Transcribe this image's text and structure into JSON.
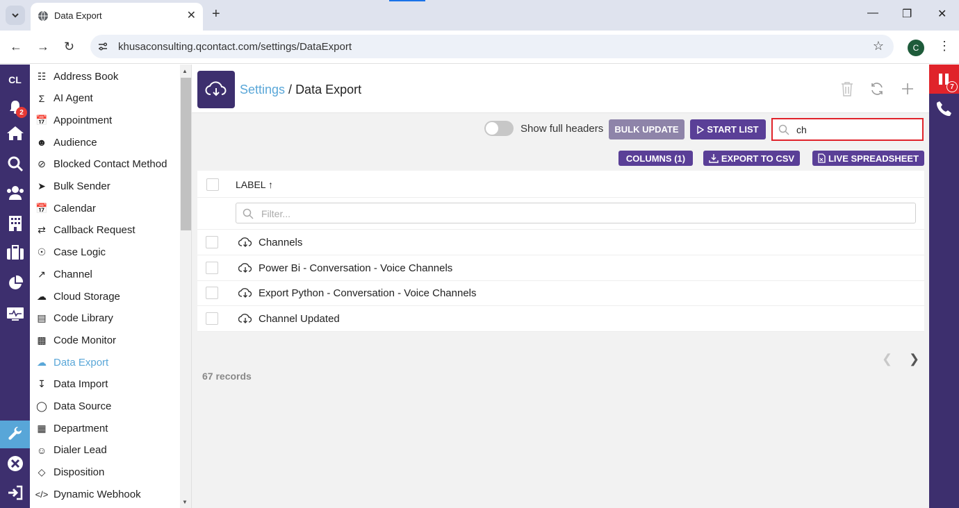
{
  "browser": {
    "tab_title": "Data Export",
    "url": "khusaconsulting.qcontact.com/settings/DataExport",
    "profile_initial": "C",
    "new_tab": "+",
    "close": "✕"
  },
  "rail": {
    "avatar": "CL",
    "notification_count": "2",
    "icons": [
      "bell-icon",
      "home-icon",
      "search-icon",
      "users-icon",
      "building-icon",
      "briefcase-icon",
      "pie-chart-icon",
      "monitor-icon",
      "wrench-icon",
      "close-circle-icon",
      "logout-icon"
    ]
  },
  "settings_list": [
    {
      "label": "Address Book",
      "icon": "address-book-icon"
    },
    {
      "label": "AI Agent",
      "icon": "sigma-icon"
    },
    {
      "label": "Appointment",
      "icon": "calendar-icon"
    },
    {
      "label": "Audience",
      "icon": "audience-icon"
    },
    {
      "label": "Blocked Contact Method",
      "icon": "blocked-icon"
    },
    {
      "label": "Bulk Sender",
      "icon": "bulk-sender-icon"
    },
    {
      "label": "Calendar",
      "icon": "calendar-icon"
    },
    {
      "label": "Callback Request",
      "icon": "callback-icon"
    },
    {
      "label": "Case Logic",
      "icon": "case-logic-icon"
    },
    {
      "label": "Channel",
      "icon": "channel-icon"
    },
    {
      "label": "Cloud Storage",
      "icon": "cloud-upload-icon"
    },
    {
      "label": "Code Library",
      "icon": "library-icon"
    },
    {
      "label": "Code Monitor",
      "icon": "code-monitor-icon"
    },
    {
      "label": "Data Export",
      "icon": "cloud-download-icon",
      "active": true
    },
    {
      "label": "Data Import",
      "icon": "import-icon"
    },
    {
      "label": "Data Source",
      "icon": "database-icon"
    },
    {
      "label": "Department",
      "icon": "department-icon"
    },
    {
      "label": "Dialer Lead",
      "icon": "dialer-lead-icon"
    },
    {
      "label": "Disposition",
      "icon": "tag-icon"
    },
    {
      "label": "Dynamic Webhook",
      "icon": "code-icon"
    }
  ],
  "header": {
    "crumb_link": "Settings",
    "crumb_sep": " / ",
    "crumb_current": "Data Export"
  },
  "toolbar": {
    "toggle_label": "Show full headers",
    "bulk_update": "BULK UPDATE",
    "start_list": "START LIST",
    "search_value": "ch",
    "columns": "COLUMNS (1)",
    "export_csv": "EXPORT TO CSV",
    "live_spreadsheet": "LIVE SPREADSHEET"
  },
  "grid": {
    "column_label": "LABEL",
    "sort_arrow": "↑",
    "filter_placeholder": "Filter...",
    "rows": [
      {
        "label": "Channels"
      },
      {
        "label": "Power Bi - Conversation - Voice Channels"
      },
      {
        "label": "Export Python - Conversation - Voice Channels"
      },
      {
        "label": "Channel Updated"
      }
    ]
  },
  "footer": {
    "records": "67 records"
  },
  "right_rail": {
    "badge": "7"
  },
  "colors": {
    "brand_purple": "#3d2f6e",
    "button_purple": "#5a3f97",
    "accent_blue": "#5aa7d8",
    "alert_red": "#e0232a"
  }
}
